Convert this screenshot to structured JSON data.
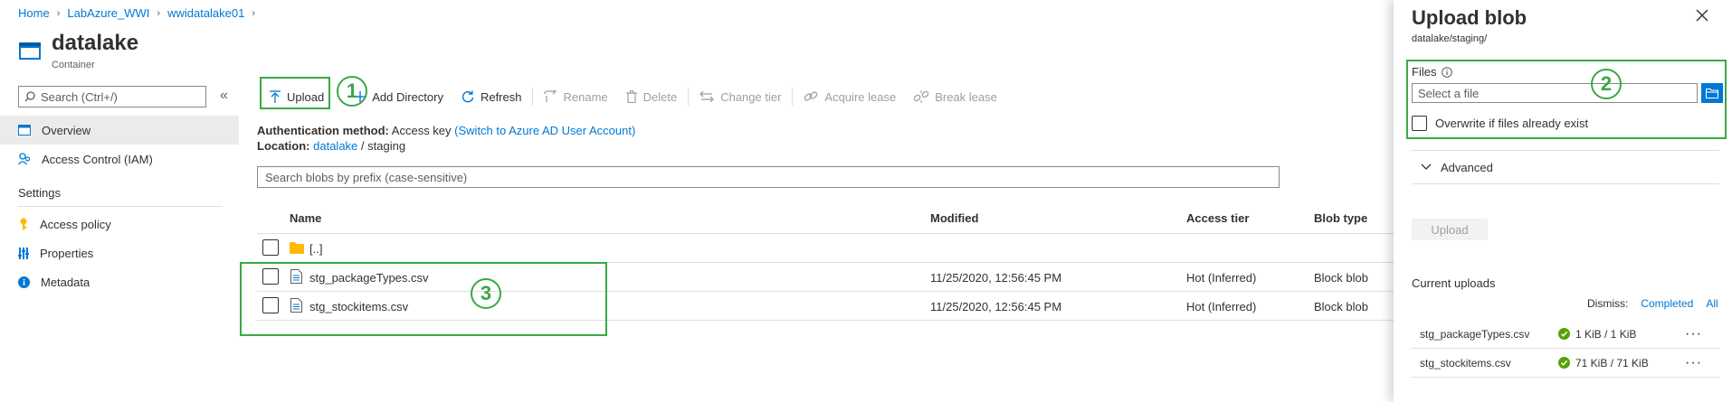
{
  "breadcrumb": [
    "Home",
    "LabAzure_WWI",
    "wwidatalake01"
  ],
  "header": {
    "title": "datalake",
    "subtitle": "Container"
  },
  "nav": {
    "search_placeholder": "Search (Ctrl+/)",
    "items": [
      {
        "label": "Overview"
      },
      {
        "label": "Access Control (IAM)"
      }
    ],
    "settings_label": "Settings",
    "settings_items": [
      {
        "label": "Access policy"
      },
      {
        "label": "Properties"
      },
      {
        "label": "Metadata"
      }
    ]
  },
  "toolbar": {
    "upload": "Upload",
    "add_directory": "Add Directory",
    "refresh": "Refresh",
    "rename": "Rename",
    "delete": "Delete",
    "change_tier": "Change tier",
    "acquire_lease": "Acquire lease",
    "break_lease": "Break lease"
  },
  "info": {
    "auth_label": "Authentication method:",
    "auth_value": "Access key",
    "auth_link": "(Switch to Azure AD User Account)",
    "location_label": "Location:",
    "location_link": "datalake",
    "location_sep": "/",
    "location_rest": "staging"
  },
  "blob_search_placeholder": "Search blobs by prefix (case-sensitive)",
  "table": {
    "headers": [
      "Name",
      "Modified",
      "Access tier",
      "Blob type"
    ],
    "parent_row": "[..]",
    "rows": [
      {
        "name": "stg_packageTypes.csv",
        "modified": "11/25/2020, 12:56:45 PM",
        "tier": "Hot (Inferred)",
        "type": "Block blob"
      },
      {
        "name": "stg_stockitems.csv",
        "modified": "11/25/2020, 12:56:45 PM",
        "tier": "Hot (Inferred)",
        "type": "Block blob"
      }
    ]
  },
  "annotations": [
    "1",
    "2",
    "3"
  ],
  "panel": {
    "title": "Upload blob",
    "subtitle": "datalake/staging/",
    "files_label": "Files",
    "file_placeholder": "Select a file",
    "overwrite_label": "Overwrite if files already exist",
    "advanced_label": "Advanced",
    "upload_button": "Upload",
    "current_uploads": "Current uploads",
    "dismiss_label": "Dismiss:",
    "dismiss_completed": "Completed",
    "dismiss_all": "All",
    "uploads": [
      {
        "name": "stg_packageTypes.csv",
        "size": "1 KiB / 1 KiB"
      },
      {
        "name": "stg_stockitems.csv",
        "size": "71 KiB / 71 KiB"
      }
    ],
    "more": "···"
  },
  "colors": {
    "accent": "#0078d4",
    "annotation": "#3aa845",
    "success": "#57a300",
    "folder": "#ffb900"
  }
}
